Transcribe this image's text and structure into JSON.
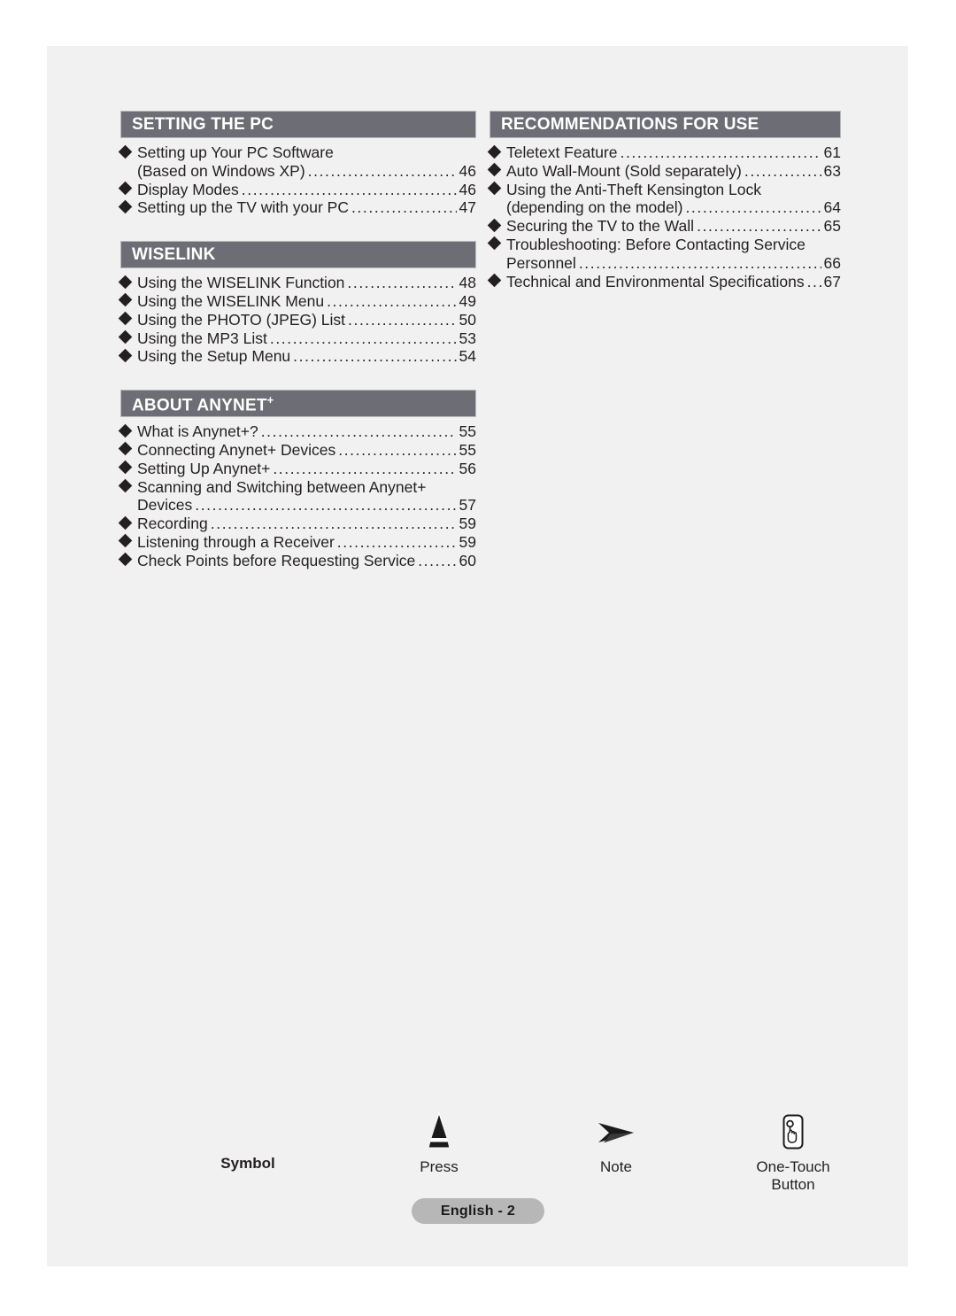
{
  "document": {
    "page_label": "English - 2"
  },
  "columns": {
    "left": [
      {
        "id": "setting-the-pc",
        "heading": "SETTING THE PC",
        "heading_sup": "",
        "entries": [
          {
            "lines": [
              {
                "text": "Setting up Your PC Software",
                "page": ""
              },
              {
                "text": "(Based on Windows XP)",
                "page": "46"
              }
            ]
          },
          {
            "lines": [
              {
                "text": "Display Modes",
                "page": "46"
              }
            ]
          },
          {
            "lines": [
              {
                "text": "Setting up the TV with your PC",
                "page": "47"
              }
            ]
          }
        ]
      },
      {
        "id": "wiselink",
        "heading": "WISELINK",
        "heading_sup": "",
        "entries": [
          {
            "lines": [
              {
                "text": "Using the WISELINK Function",
                "page": "48"
              }
            ]
          },
          {
            "lines": [
              {
                "text": "Using the WISELINK Menu",
                "page": "49"
              }
            ]
          },
          {
            "lines": [
              {
                "text": "Using the PHOTO (JPEG) List",
                "page": "50"
              }
            ]
          },
          {
            "lines": [
              {
                "text": "Using the MP3 List",
                "page": "53"
              }
            ]
          },
          {
            "lines": [
              {
                "text": "Using the Setup Menu",
                "page": "54"
              }
            ]
          }
        ]
      },
      {
        "id": "about-anynet",
        "heading": "ABOUT ANYNET",
        "heading_sup": "+",
        "entries": [
          {
            "lines": [
              {
                "text": "What is Anynet+?",
                "page": "55"
              }
            ]
          },
          {
            "lines": [
              {
                "text": "Connecting Anynet+ Devices",
                "page": "55"
              }
            ]
          },
          {
            "lines": [
              {
                "text": "Setting Up Anynet+",
                "page": "56"
              }
            ]
          },
          {
            "lines": [
              {
                "text": "Scanning and Switching between Anynet+",
                "page": ""
              },
              {
                "text": "Devices",
                "page": "57"
              }
            ]
          },
          {
            "lines": [
              {
                "text": "Recording",
                "page": "59"
              }
            ]
          },
          {
            "lines": [
              {
                "text": "Listening through a Receiver",
                "page": "59"
              }
            ]
          },
          {
            "lines": [
              {
                "text": "Check Points before Requesting Service",
                "page": "60"
              }
            ]
          }
        ]
      }
    ],
    "right": [
      {
        "id": "recommendations-for-use",
        "heading": "RECOMMENDATIONS FOR USE",
        "heading_sup": "",
        "entries": [
          {
            "lines": [
              {
                "text": "Teletext Feature",
                "page": "61"
              }
            ]
          },
          {
            "lines": [
              {
                "text": "Auto Wall-Mount (Sold separately)",
                "page": "63"
              }
            ]
          },
          {
            "lines": [
              {
                "text": "Using the Anti-Theft Kensington Lock",
                "page": ""
              },
              {
                "text": "(depending on the model)",
                "page": "64"
              }
            ]
          },
          {
            "lines": [
              {
                "text": "Securing the TV to the Wall",
                "page": "65"
              }
            ]
          },
          {
            "lines": [
              {
                "text": "Troubleshooting: Before Contacting Service",
                "page": ""
              },
              {
                "text": "Personnel",
                "page": "66"
              }
            ]
          },
          {
            "lines": [
              {
                "text": "Technical and Environmental Specifications",
                "page": "67"
              }
            ]
          }
        ]
      }
    ]
  },
  "legend": {
    "symbol_label": "Symbol",
    "items": [
      {
        "icon": "press-triangle-icon",
        "label": "Press"
      },
      {
        "icon": "note-arrow-icon",
        "label": "Note"
      },
      {
        "icon": "one-touch-button-icon",
        "label": "One-Touch\nButton"
      }
    ],
    "one_touch_line1": "One-Touch",
    "one_touch_line2": "Button"
  },
  "colors": {
    "page_background": "#f1f1f1",
    "section_header_bg": "#6d6d75",
    "section_header_border": "#b9b9bf",
    "text": "#231f20",
    "badge_bg": "#b7b7b7"
  }
}
